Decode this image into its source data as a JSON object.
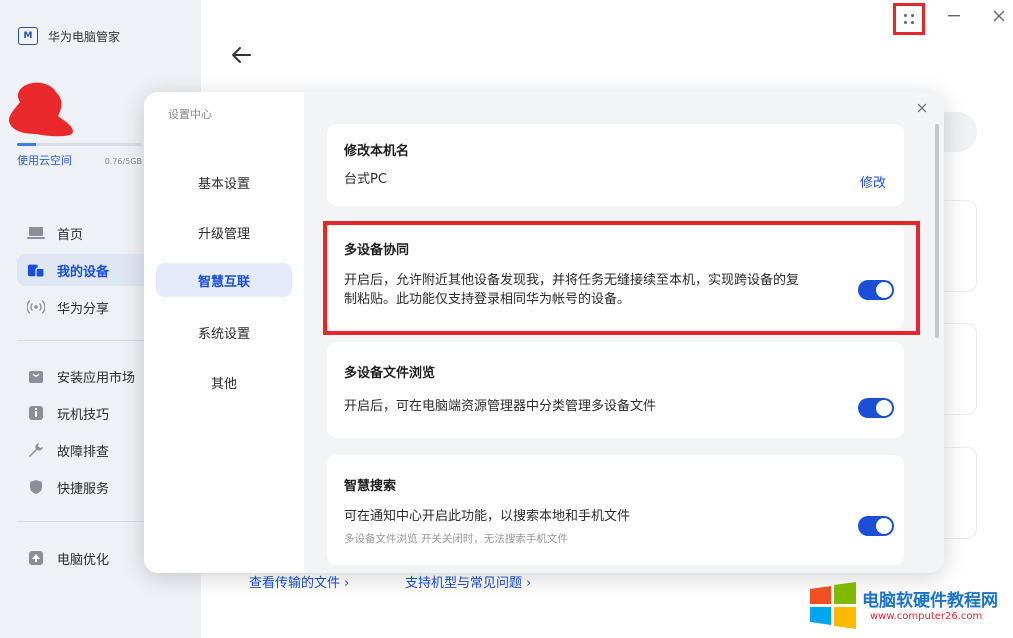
{
  "app": {
    "title": "华为电脑管家"
  },
  "cloud": {
    "label": "使用云空间",
    "usage": "0.76/5GB",
    "fill_percent": 15
  },
  "sidebar": {
    "items": [
      {
        "label": "首页",
        "icon": "laptop-icon"
      },
      {
        "label": "我的设备",
        "icon": "devices-icon",
        "active": true
      },
      {
        "label": "华为分享",
        "icon": "wireless-share-icon"
      },
      {
        "label": "安装应用市场",
        "icon": "store-bag-icon"
      },
      {
        "label": "玩机技巧",
        "icon": "info-icon"
      },
      {
        "label": "故障排查",
        "icon": "wrench-icon"
      },
      {
        "label": "快捷服务",
        "icon": "shield-icon"
      },
      {
        "label": "电脑优化",
        "icon": "optimize-icon"
      }
    ]
  },
  "bottom_links": {
    "transfer": "查看传输的文件 ›",
    "faq": "支持机型与常见问题 ›"
  },
  "settings": {
    "title": "设置中心",
    "menu": [
      "基本设置",
      "升级管理",
      "智慧互联",
      "系统设置",
      "其他"
    ],
    "active_menu": "智慧互联",
    "rename": {
      "title": "修改本机名",
      "device_name": "台式PC",
      "action": "修改"
    },
    "multi_device": {
      "title": "多设备协同",
      "desc_line1": "开启后，允许附近其他设备发现我，并将任务无缝接续至本机，实现跨设备的复",
      "desc_line2": "制粘贴。此功能仅支持登录相同华为帐号的设备。",
      "enabled": true
    },
    "file_browse": {
      "title": "多设备文件浏览",
      "desc": "开启后，可在电脑端资源管理器中分类管理多设备文件",
      "enabled": true
    },
    "smart_search": {
      "title": "智慧搜索",
      "desc": "可在通知中心开启此功能，以搜索本地和手机文件",
      "note": "多设备文件浏览 开关关闭时，无法搜索手机文件",
      "enabled": true
    }
  },
  "watermark": {
    "title": "电脑软硬件教程网",
    "url": "www.computer26.com"
  },
  "colors": {
    "accent": "#1b4fd8",
    "highlight": "#e5262d",
    "sidebar_bg": "#eef1f5"
  }
}
